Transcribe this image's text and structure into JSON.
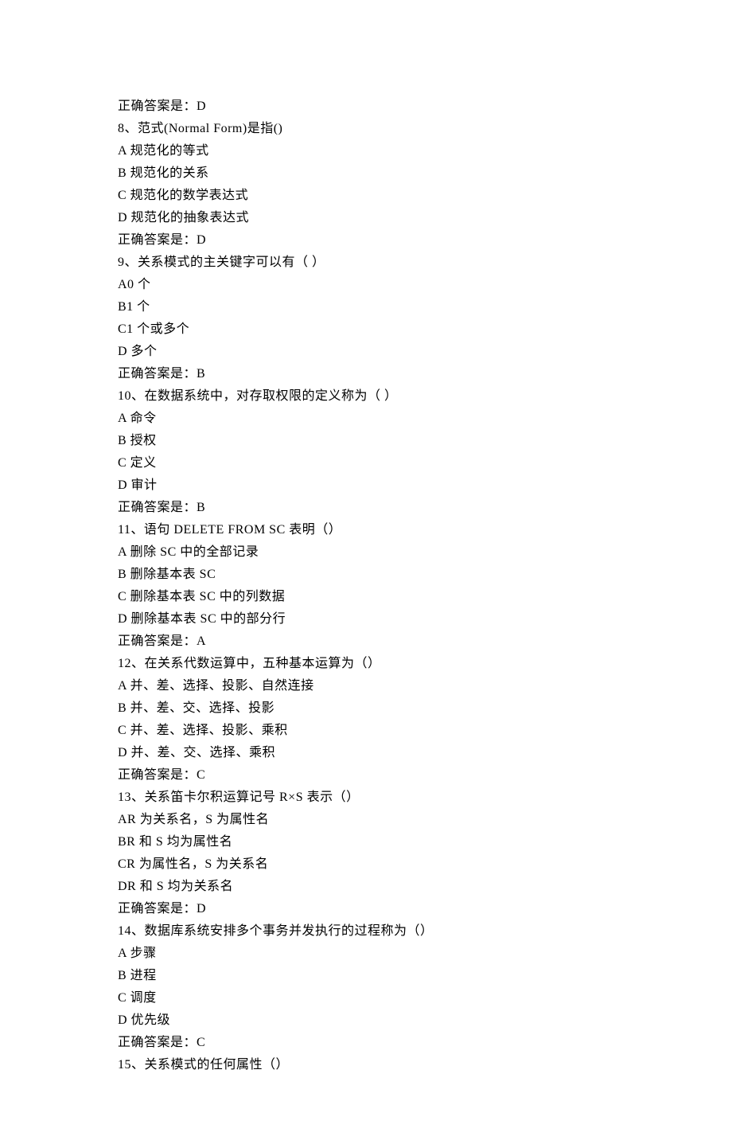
{
  "lines": [
    "正确答案是：D",
    "8、范式(Normal Form)是指()",
    "A 规范化的等式",
    "B 规范化的关系",
    "C 规范化的数学表达式",
    "D 规范化的抽象表达式",
    "正确答案是：D",
    "9、关系模式的主关键字可以有（ ）",
    "A0 个",
    "B1 个",
    "C1 个或多个",
    "D 多个",
    "正确答案是：B",
    "10、在数据系统中，对存取权限的定义称为（ ）",
    "A 命令",
    "B 授权",
    "C 定义",
    "D 审计",
    "正确答案是：B",
    "11、语句 DELETE FROM SC 表明（）",
    "A 删除 SC 中的全部记录",
    "B 删除基本表 SC",
    "C 删除基本表 SC 中的列数据",
    "D 删除基本表 SC 中的部分行",
    "正确答案是：A",
    "12、在关系代数运算中，五种基本运算为（）",
    "A 并、差、选择、投影、自然连接",
    "B 并、差、交、选择、投影",
    "C 并、差、选择、投影、乘积",
    "D 并、差、交、选择、乘积",
    "正确答案是：C",
    "13、关系笛卡尔积运算记号 R×S 表示（）",
    "AR 为关系名，S 为属性名",
    "BR 和 S 均为属性名",
    "CR 为属性名，S 为关系名",
    "DR 和 S 均为关系名",
    "正确答案是：D",
    "14、数据库系统安排多个事务并发执行的过程称为（）",
    "A 步骤",
    "B 进程",
    "C 调度",
    "D 优先级",
    "正确答案是：C",
    "15、关系模式的任何属性（）"
  ]
}
